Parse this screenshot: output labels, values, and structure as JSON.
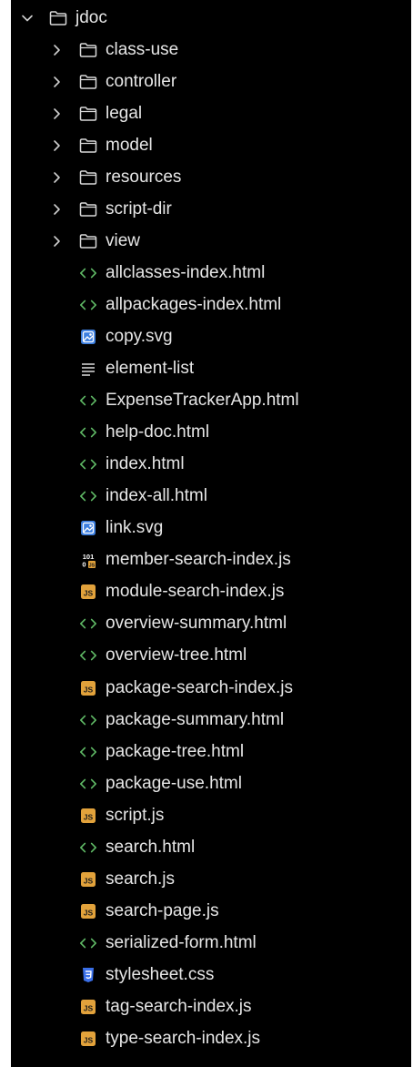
{
  "tree": {
    "root": {
      "label": "jdoc",
      "icon": "folder-icon",
      "expanded": true
    },
    "children": [
      {
        "label": "class-use",
        "type": "folder",
        "icon": "folder-icon"
      },
      {
        "label": "controller",
        "type": "folder",
        "icon": "folder-icon"
      },
      {
        "label": "legal",
        "type": "folder",
        "icon": "folder-icon"
      },
      {
        "label": "model",
        "type": "folder",
        "icon": "folder-icon"
      },
      {
        "label": "resources",
        "type": "folder",
        "icon": "folder-icon"
      },
      {
        "label": "script-dir",
        "type": "folder",
        "icon": "folder-icon"
      },
      {
        "label": "view",
        "type": "folder",
        "icon": "folder-icon"
      },
      {
        "label": "allclasses-index.html",
        "type": "html",
        "icon": "html-file-icon"
      },
      {
        "label": "allpackages-index.html",
        "type": "html",
        "icon": "html-file-icon"
      },
      {
        "label": "copy.svg",
        "type": "svg",
        "icon": "svg-file-icon"
      },
      {
        "label": "element-list",
        "type": "text",
        "icon": "text-file-icon"
      },
      {
        "label": "ExpenseTrackerApp.html",
        "type": "html",
        "icon": "html-file-icon"
      },
      {
        "label": "help-doc.html",
        "type": "html",
        "icon": "html-file-icon"
      },
      {
        "label": "index.html",
        "type": "html",
        "icon": "html-file-icon"
      },
      {
        "label": "index-all.html",
        "type": "html",
        "icon": "html-file-icon"
      },
      {
        "label": "link.svg",
        "type": "svg",
        "icon": "svg-file-icon"
      },
      {
        "label": "member-search-index.js",
        "type": "binary",
        "icon": "binary-file-icon"
      },
      {
        "label": "module-search-index.js",
        "type": "js",
        "icon": "js-file-icon"
      },
      {
        "label": "overview-summary.html",
        "type": "html",
        "icon": "html-file-icon"
      },
      {
        "label": "overview-tree.html",
        "type": "html",
        "icon": "html-file-icon"
      },
      {
        "label": "package-search-index.js",
        "type": "js",
        "icon": "js-file-icon"
      },
      {
        "label": "package-summary.html",
        "type": "html",
        "icon": "html-file-icon"
      },
      {
        "label": "package-tree.html",
        "type": "html",
        "icon": "html-file-icon"
      },
      {
        "label": "package-use.html",
        "type": "html",
        "icon": "html-file-icon"
      },
      {
        "label": "script.js",
        "type": "js",
        "icon": "js-file-icon"
      },
      {
        "label": "search.html",
        "type": "html",
        "icon": "html-file-icon"
      },
      {
        "label": "search.js",
        "type": "js",
        "icon": "js-file-icon"
      },
      {
        "label": "search-page.js",
        "type": "js",
        "icon": "js-file-icon"
      },
      {
        "label": "serialized-form.html",
        "type": "html",
        "icon": "html-file-icon"
      },
      {
        "label": "stylesheet.css",
        "type": "css",
        "icon": "css-file-icon"
      },
      {
        "label": "tag-search-index.js",
        "type": "js",
        "icon": "js-file-icon"
      },
      {
        "label": "type-search-index.js",
        "type": "js",
        "icon": "js-file-icon"
      }
    ]
  },
  "colors": {
    "background": "#000000",
    "text": "#e6e6e6",
    "html_icon": "#5fb865",
    "js_icon": "#e2a23b",
    "svg_icon": "#3d7fe0",
    "css_icon": "#3a6fe8"
  }
}
